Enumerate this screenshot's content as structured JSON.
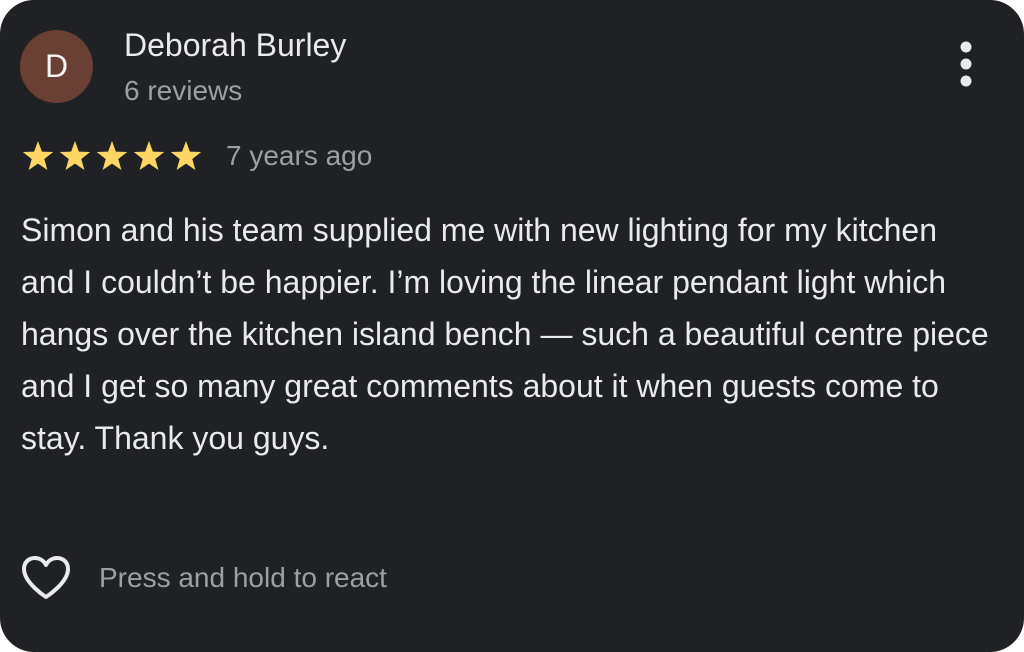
{
  "review": {
    "author": {
      "initial": "D",
      "name": "Deborah Burley",
      "review_count": "6 reviews",
      "avatar_color": "#6b4034"
    },
    "more_options_icon": "more-vert-icon",
    "rating": 5,
    "rating_max": 5,
    "star_color": "#fdd663",
    "time_ago": "7 years ago",
    "text": "Simon and his team supplied me with new lighting for my kitchen and I couldn’t be happier. I’m loving the linear pendant light which hangs over the kitchen island bench — such a beautiful centre piece and I get so many great comments about it when guests come to stay. Thank you guys.",
    "react": {
      "icon": "heart-outline-icon",
      "label": "Press and hold to react"
    }
  },
  "colors": {
    "background": "#202124",
    "primary_text": "#e8eaed",
    "secondary_text": "#9aa0a6"
  }
}
